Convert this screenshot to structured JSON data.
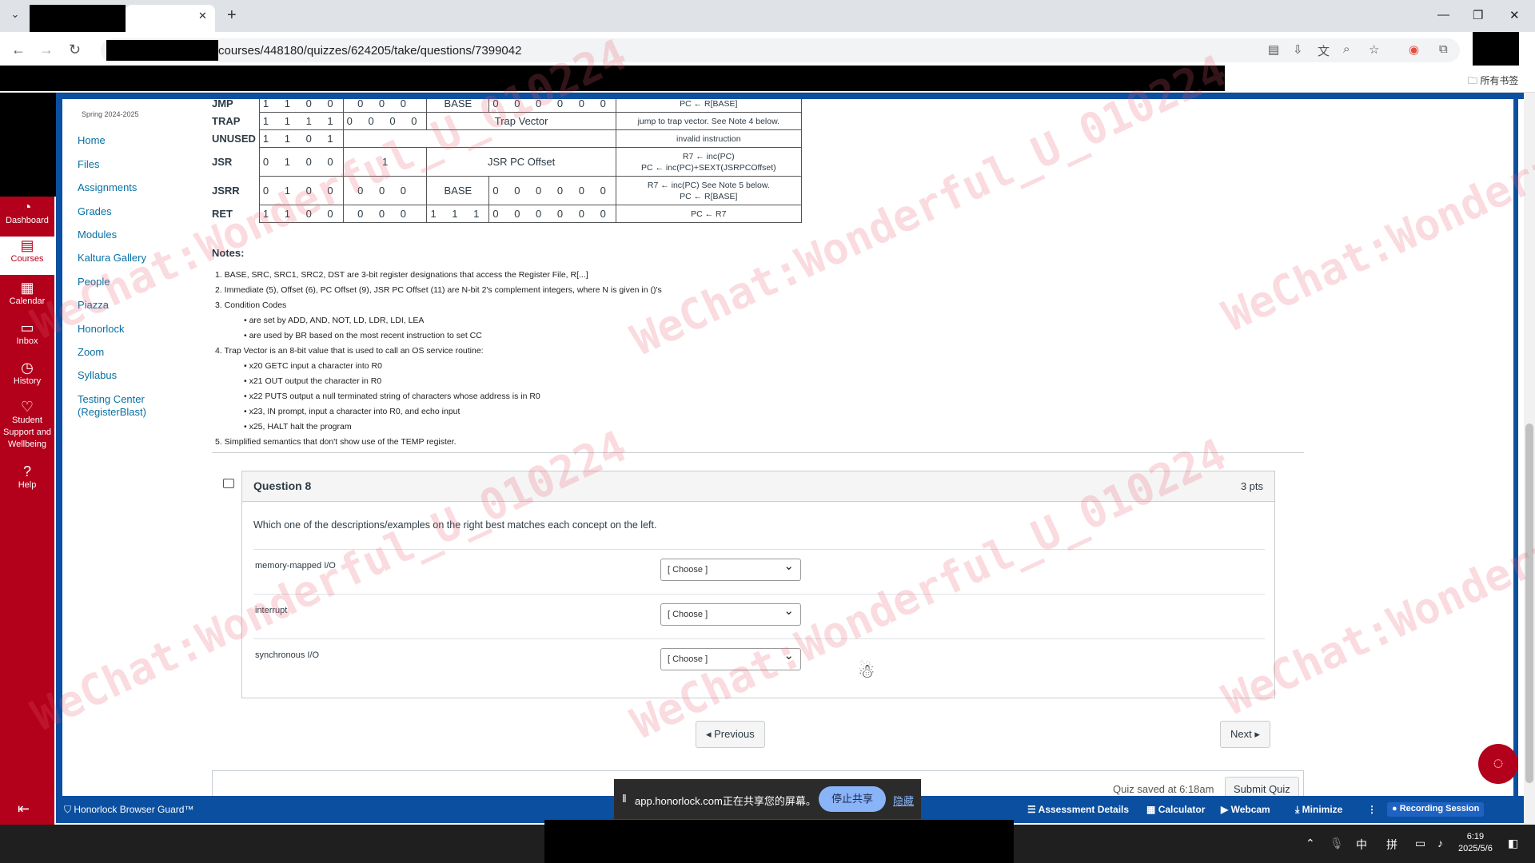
{
  "browser": {
    "url": "courses/448180/quizzes/624205/take/questions/7399042",
    "bookmark_folder": "所有书签"
  },
  "global_nav": [
    {
      "label": "Dashboard",
      "icon": "dashboard-icon"
    },
    {
      "label": "Courses",
      "icon": "courses-icon"
    },
    {
      "label": "Calendar",
      "icon": "calendar-icon"
    },
    {
      "label": "Inbox",
      "icon": "inbox-icon"
    },
    {
      "label": "History",
      "icon": "history-icon"
    },
    {
      "label": "Student Support and Wellbeing",
      "icon": "support-icon"
    },
    {
      "label": "Help",
      "icon": "help-icon"
    }
  ],
  "course_nav": {
    "term": "Spring 2024-2025",
    "items": [
      "Home",
      "Files",
      "Assignments",
      "Grades",
      "Modules",
      "Kaltura Gallery",
      "People",
      "Piazza",
      "Honorlock",
      "Zoom",
      "Syllabus",
      "Testing Center (RegisterBlast)"
    ]
  },
  "isa_table": {
    "rows": [
      {
        "op": "JMP",
        "cells": [
          "1 1 0 0",
          "0 0 0",
          "BASE",
          "0 0 0 0 0 0"
        ],
        "desc": "PC ← R[BASE]"
      },
      {
        "op": "TRAP",
        "cells": [
          "1 1 1 1",
          "0 0 0 0",
          "Trap Vector"
        ],
        "desc": "jump to trap vector. See Note 4 below."
      },
      {
        "op": "UNUSED",
        "cells": [
          "1 1 0 1"
        ],
        "desc": "invalid instruction"
      },
      {
        "op": "JSR",
        "cells": [
          "0 1 0 0",
          "1",
          "JSR PC Offset"
        ],
        "desc": "R7 ← inc(PC)",
        "desc2": "PC ← inc(PC)+SEXT(JSRPCOffset)"
      },
      {
        "op": "JSRR",
        "cells": [
          "0 1 0 0",
          "0",
          "0 0",
          "BASE",
          "0 0 0 0 0 0"
        ],
        "desc": "R7 ← inc(PC)   See Note 5 below.",
        "desc2": "PC ← R[BASE]"
      },
      {
        "op": "RET",
        "cells": [
          "1 1 0 0",
          "0 0 0",
          "1 1 1",
          "0 0 0 0 0 0"
        ],
        "desc": "PC ← R7"
      }
    ]
  },
  "notes": {
    "heading": "Notes:",
    "n1": "1. BASE, SRC, SRC1, SRC2, DST are 3-bit register designations that access the Register File, R[...]",
    "n2": "2. Immediate (5), Offset (6), PC Offset (9), JSR PC Offset (11) are N-bit 2's complement integers, where N is given in ()'s",
    "n3": "3. Condition Codes",
    "n3a": "are set by ADD, AND, NOT, LD, LDR, LDI, LEA",
    "n3b": "are used by BR based on the most recent instruction to set CC",
    "n4": "4. Trap Vector is an 8-bit value that is used to call an OS service routine:",
    "n4a": "x20 GETC input a character into R0",
    "n4b": "x21 OUT output the character in R0",
    "n4c": "x22 PUTS output a null terminated string of characters whose address is in R0",
    "n4d": "x23, IN prompt, input a character into R0, and echo input",
    "n4e": "x25, HALT halt the program",
    "n5": "5. Simplified semantics that don't show use of the TEMP register."
  },
  "question": {
    "title": "Question 8",
    "points": "3 pts",
    "text": "Which one of the descriptions/examples on the right best matches each concept on the left.",
    "matches": [
      {
        "label": "memory-mapped I/O",
        "selected": "[ Choose ]"
      },
      {
        "label": "interrupt",
        "selected": "[ Choose ]"
      },
      {
        "label": "synchronous I/O",
        "selected": "[ Choose ]"
      }
    ]
  },
  "pagination": {
    "previous": "◂ Previous",
    "next": "Next ▸"
  },
  "footer": {
    "saved": "Quiz saved at 6:18am",
    "submit": "Submit Quiz"
  },
  "proctor_bar": {
    "guard": "Honorlock Browser Guard™",
    "assessment": "Assessment Details",
    "calculator": "Calculator",
    "webcam": "Webcam",
    "minimize": "Minimize",
    "recording": "Recording Session"
  },
  "share_bar": {
    "text": "app.honorlock.com正在共享您的屏幕。",
    "stop": "停止共享",
    "hide": "隐藏"
  },
  "taskbar": {
    "ime1": "中",
    "ime2": "拼",
    "time": "6:19",
    "date": "2025/5/6"
  },
  "watermark": "WeChat:Wonderful_U_010224",
  "colors": {
    "canvas_red": "#b3001b",
    "honorlock_blue": "#0b4fa0",
    "link_blue": "#0770a3"
  }
}
